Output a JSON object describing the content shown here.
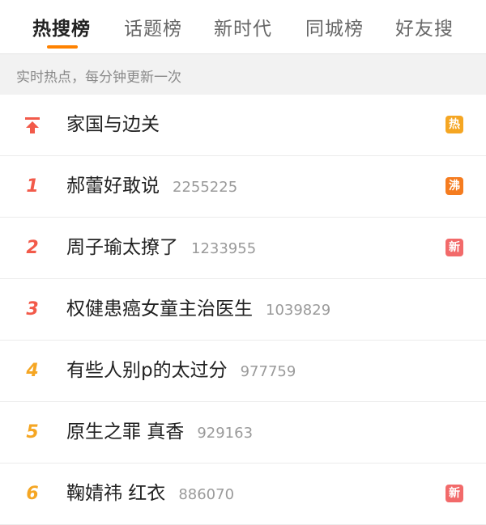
{
  "tabs": [
    {
      "label": "热搜榜",
      "active": true
    },
    {
      "label": "话题榜",
      "active": false
    },
    {
      "label": "新时代",
      "active": false
    },
    {
      "label": "同城榜",
      "active": false
    },
    {
      "label": "好友搜",
      "active": false
    }
  ],
  "subtitle": "实时热点，每分钟更新一次",
  "items": [
    {
      "rank": "",
      "title": "家国与边关",
      "count": "",
      "badge": "热",
      "badge_type": "hot"
    },
    {
      "rank": "1",
      "title": "郝蕾好敢说",
      "count": "2255225",
      "badge": "沸",
      "badge_type": "boil"
    },
    {
      "rank": "2",
      "title": "周子瑜太撩了",
      "count": "1233955",
      "badge": "新",
      "badge_type": "new"
    },
    {
      "rank": "3",
      "title": "权健患癌女童主治医生",
      "count": "1039829",
      "badge": "",
      "badge_type": ""
    },
    {
      "rank": "4",
      "title": "有些人别p的太过分",
      "count": "977759",
      "badge": "",
      "badge_type": ""
    },
    {
      "rank": "5",
      "title": "原生之罪 真香",
      "count": "929163",
      "badge": "",
      "badge_type": ""
    },
    {
      "rank": "6",
      "title": "鞠婧祎 红衣",
      "count": "886070",
      "badge": "新",
      "badge_type": "new"
    }
  ],
  "colors": {
    "accent": "#ff8200",
    "rank_top3": "#f25a4a",
    "rank_rest": "#f5a623",
    "badge_hot": "#f5a623",
    "badge_boil": "#f57c1f",
    "badge_new": "#f26a6a"
  },
  "icons": {
    "pinned": "pin-top-arrow-icon"
  }
}
